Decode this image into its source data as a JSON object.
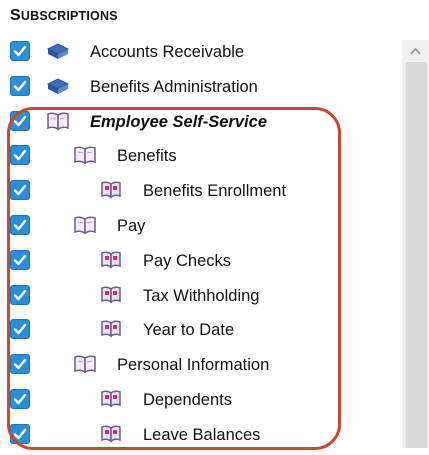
{
  "section": {
    "title_cap": "S",
    "title_rest": "UBSCRIPTIONS"
  },
  "colors": {
    "checkbox": "#2a8fd6",
    "highlight": "#c64a33",
    "book_icon": "#7b6a9c"
  },
  "items": [
    {
      "label": "Accounts Receivable",
      "level": 0,
      "icon": "module-icon",
      "checked": true
    },
    {
      "label": "Benefits Administration",
      "level": 0,
      "icon": "module-icon",
      "checked": true
    },
    {
      "label": "Employee Self-Service",
      "level": 0,
      "icon": "book-open-icon",
      "checked": true,
      "emphasis": true
    },
    {
      "label": "Benefits",
      "level": 1,
      "icon": "book-open-icon",
      "checked": true
    },
    {
      "label": "Benefits Enrollment",
      "level": 2,
      "icon": "book-page-icon",
      "checked": true
    },
    {
      "label": "Pay",
      "level": 1,
      "icon": "book-open-icon",
      "checked": true
    },
    {
      "label": "Pay Checks",
      "level": 2,
      "icon": "book-page-icon",
      "checked": true
    },
    {
      "label": "Tax Withholding",
      "level": 2,
      "icon": "book-page-icon",
      "checked": true
    },
    {
      "label": "Year to Date",
      "level": 2,
      "icon": "book-page-icon",
      "checked": true
    },
    {
      "label": "Personal Information",
      "level": 1,
      "icon": "book-open-icon",
      "checked": true
    },
    {
      "label": "Dependents",
      "level": 2,
      "icon": "book-page-icon",
      "checked": true
    },
    {
      "label": "Leave Balances",
      "level": 2,
      "icon": "book-page-icon",
      "checked": true
    }
  ]
}
